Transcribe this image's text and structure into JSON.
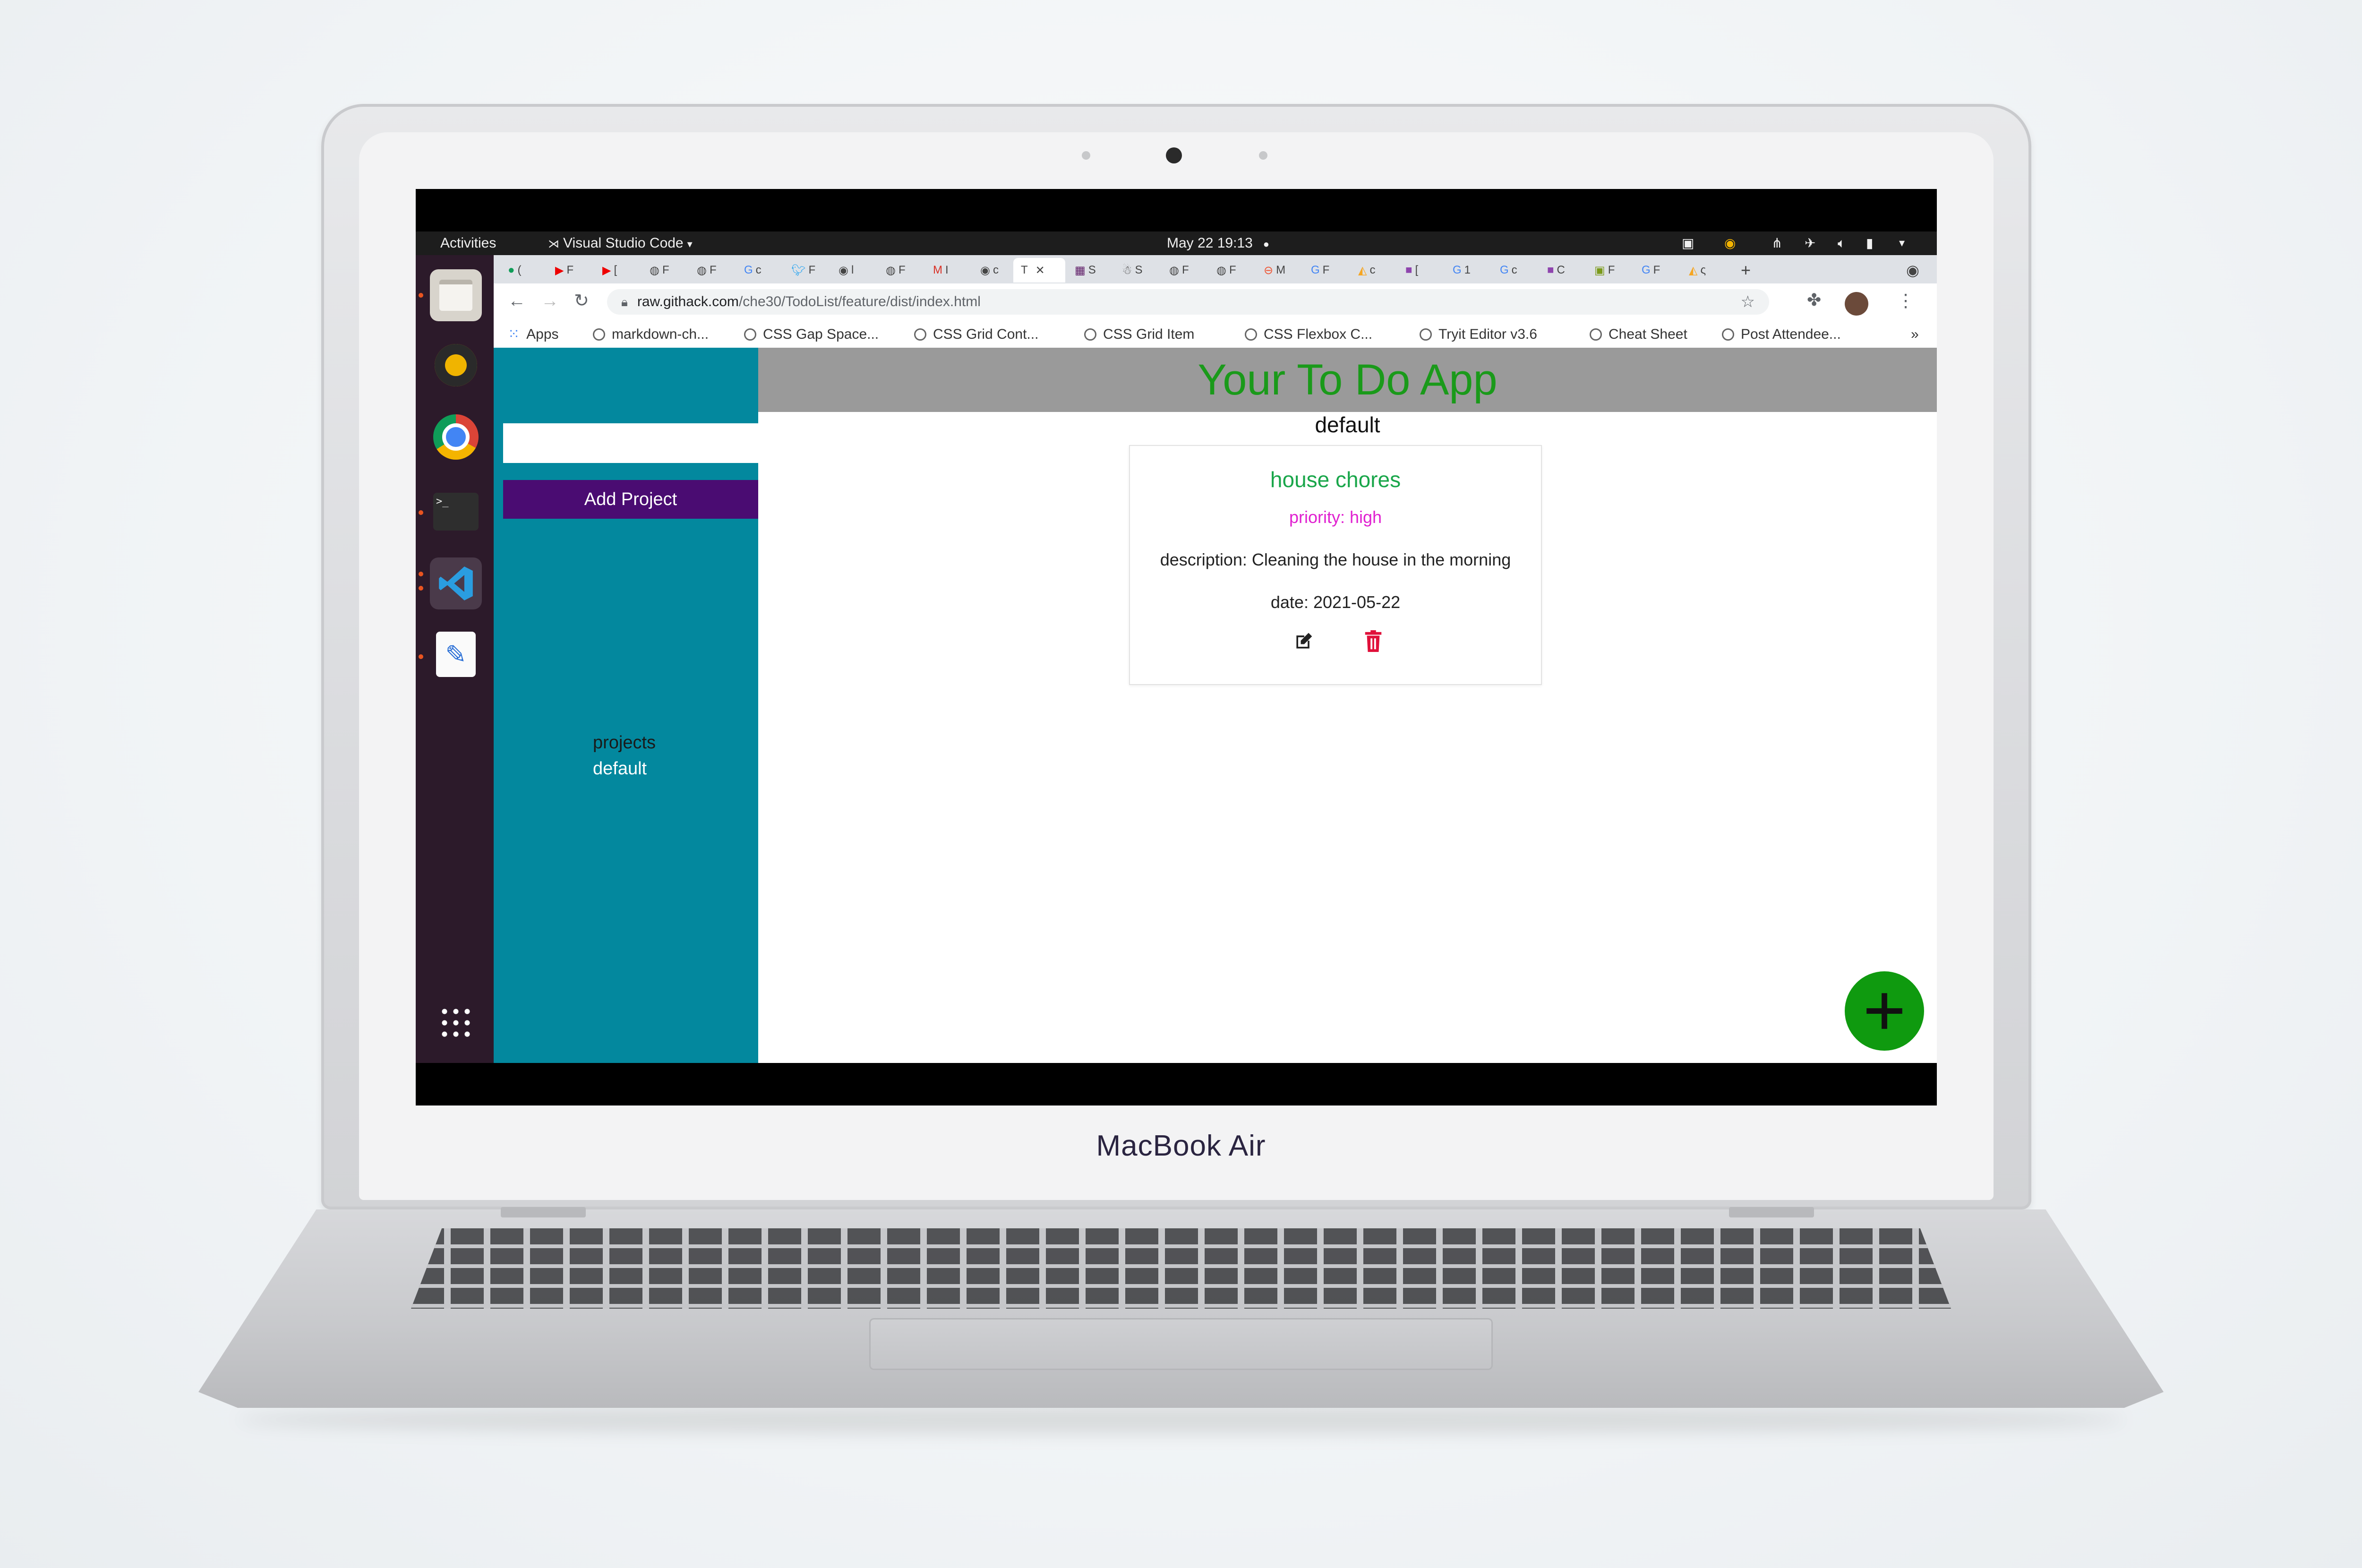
{
  "device": {
    "brand": "MacBook Air"
  },
  "gnome": {
    "activities": "Activities",
    "app_name": "Visual Studio Code",
    "datetime": "May 22  19:13"
  },
  "browser": {
    "tabs": [
      "(",
      "F",
      "[",
      "F",
      "F",
      "c",
      "F",
      "l",
      "F",
      "I",
      "c",
      "T",
      "S",
      "S",
      "F",
      "F",
      "M",
      "F",
      "c",
      "[",
      "1",
      "c",
      "C",
      "F",
      "F",
      "ς"
    ],
    "active_tab_index": 11,
    "url_host": "raw.githack.com",
    "url_path": "/che30/TodoList/feature/dist/index.html",
    "bookmarks": [
      "Apps",
      "markdown-ch...",
      "CSS Gap Space...",
      "CSS Grid Cont...",
      "CSS Grid Item",
      "CSS Flexbox C...",
      "Tryit Editor v3.6",
      "Cheat Sheet",
      "Post Attendee..."
    ],
    "more_bookmarks": "»"
  },
  "app": {
    "title": "Your To Do App",
    "current_project": "default",
    "sidebar": {
      "input_value": "",
      "add_project_label": "Add Project",
      "projects_label": "projects",
      "projects": [
        "default"
      ]
    },
    "todos": [
      {
        "title": "house chores",
        "priority": "priority: high",
        "description": "description: Cleaning the house in the morning",
        "date": "date: 2021-05-22"
      }
    ]
  },
  "colors": {
    "sidebar": "#03889e",
    "add_project_button": "#4a0c72",
    "header": "#9a9a9a",
    "title_green": "#1a9a1a",
    "priority_magenta": "#e020d0",
    "delete_red": "#e0103a",
    "fab_green": "#0f9a0f"
  }
}
